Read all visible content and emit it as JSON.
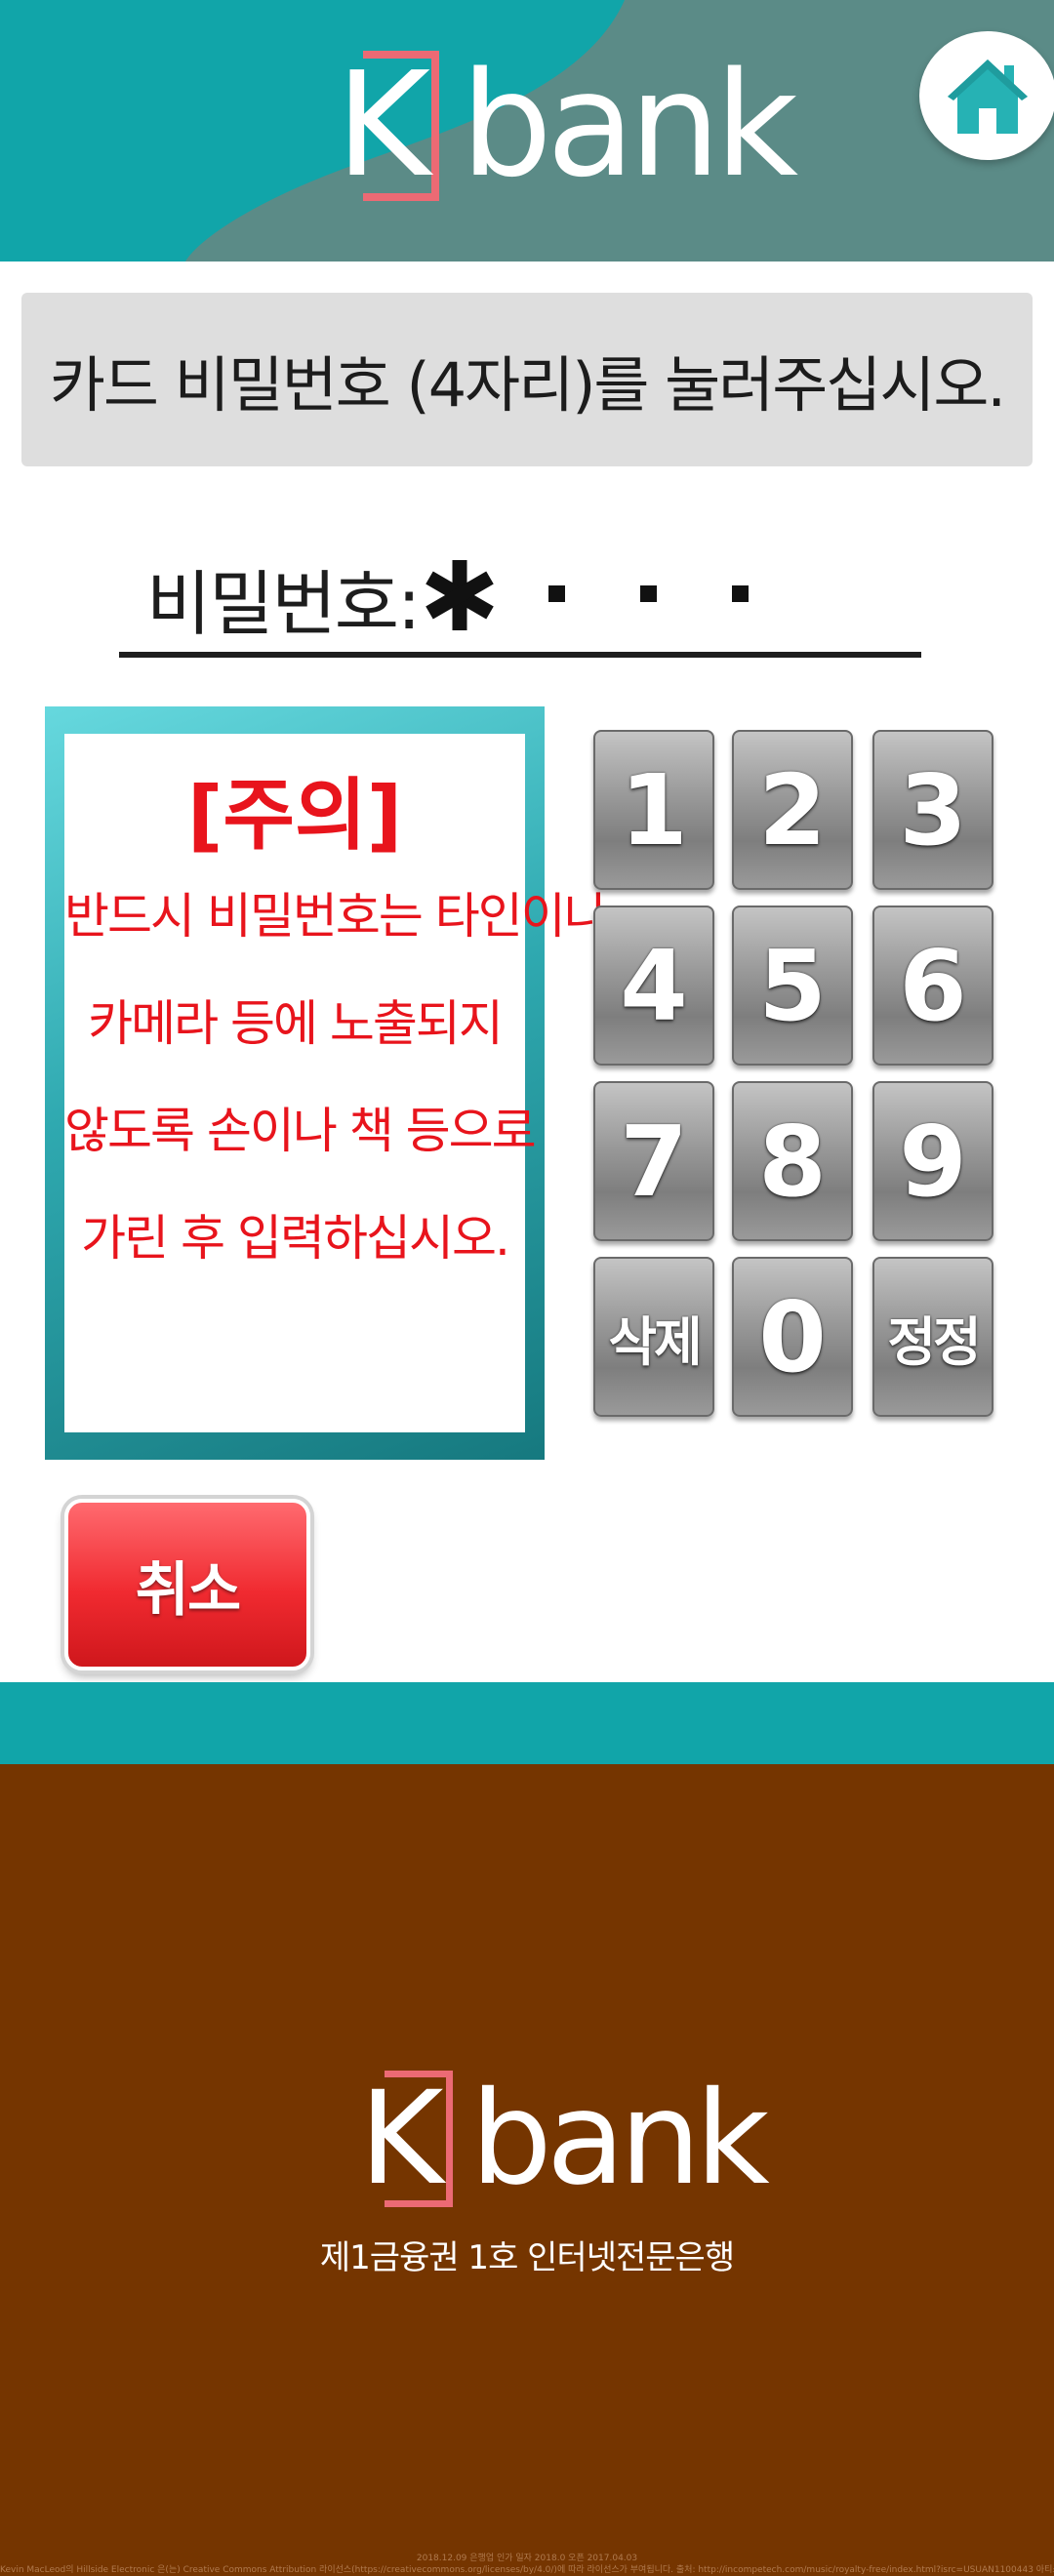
{
  "header": {
    "logo_letter": "K",
    "logo_word": "bank",
    "home_icon": "home-icon"
  },
  "instruction": "카드 비밀번호 (4자리)를 눌러주십시오.",
  "password": {
    "label": "비밀번호:",
    "entered_digits": 1,
    "total_digits": 4
  },
  "caution": {
    "title": "[주의]",
    "lines": [
      "반드시 비밀번호는 타인이나",
      "카메라 등에 노출되지",
      "않도록 손이나 책 등으로",
      "가린 후 입력하십시오."
    ]
  },
  "keypad": {
    "keys": [
      "1",
      "2",
      "3",
      "4",
      "5",
      "6",
      "7",
      "8",
      "9",
      "삭제",
      "0",
      "정정"
    ]
  },
  "cancel_label": "취소",
  "footer": {
    "logo_letter": "K",
    "logo_word": "bank",
    "tagline": "제1금융권 1호 인터넷전문은행",
    "credit_line1": "2018.12.09 은행업 인가 일자 2018.0 오픈 2017.04.03",
    "credit_line2": "Kevin MacLeod의 Hillside Electronic 은(는) Creative Commons Attribution 라이선스(https://creativecommons.org/licenses/by/4.0/)에 따라 라이선스가 부여됩니다. 출처: http://incompetech.com/music/royalty-free/index.html?isrc=USUAN1100443 아티스트: http://incompetech.com/"
  },
  "colors": {
    "header_bg": "#5b8b87",
    "header_wave": "#11a5a9",
    "logo_bracket": "#ec6a74",
    "caution_text": "#e8141c",
    "footer_bg": "#753500",
    "teal_band": "#11a5a9"
  }
}
